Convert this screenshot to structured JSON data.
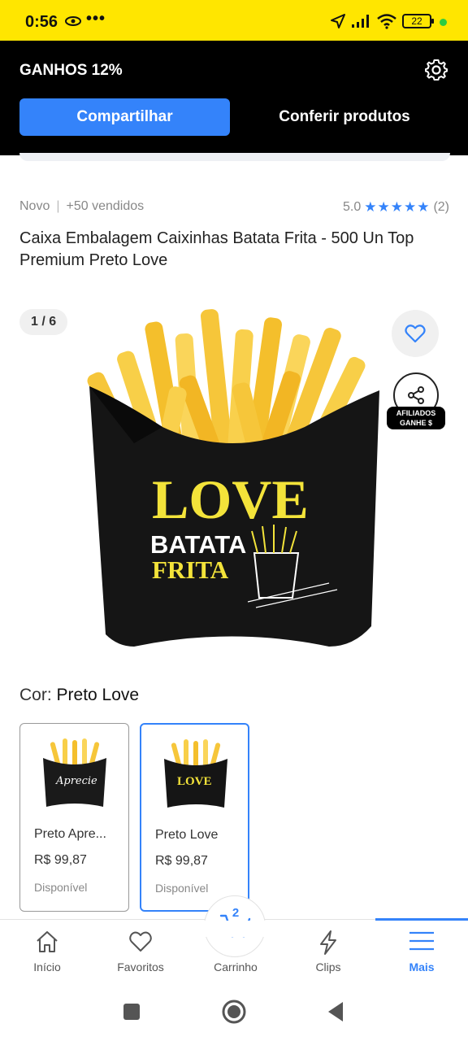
{
  "status_bar": {
    "time": "0:56",
    "dots": "•••",
    "battery": "22"
  },
  "affiliate": {
    "title": "GANHOS 12%",
    "share_button": "Compartilhar",
    "check_products": "Conferir produtos"
  },
  "product": {
    "condition": "Novo",
    "separator": "|",
    "sold": "+50 vendidos",
    "rating_value": "5.0",
    "stars": "★★★★★",
    "rating_count": "(2)",
    "title": "Caixa Embalagem Caixinhas Batata Frita - 500 Un Top Premium Preto Love"
  },
  "gallery": {
    "counter": "1 / 6",
    "affiliate_badge": "AFILIADOS\nGANHE $",
    "box_text_love": "LOVE",
    "box_text_batata": "BATATA",
    "box_text_frita": "FRITA"
  },
  "color": {
    "label": "Cor:",
    "selected": "Preto Love",
    "variants": [
      {
        "name": "Preto Apre...",
        "price": "R$ 99,87",
        "status": "Disponível",
        "thumb_text": "Aprecie"
      },
      {
        "name": "Preto Love",
        "price": "R$ 99,87",
        "status": "Disponível",
        "thumb_text": "LOVE"
      }
    ]
  },
  "nav": {
    "home": "Início",
    "favorites": "Favoritos",
    "cart": "Carrinho",
    "cart_count": "2",
    "clips": "Clips",
    "more": "Mais"
  },
  "colors": {
    "accent": "#3483fa",
    "yellow": "#ffe600",
    "black": "#000000"
  }
}
